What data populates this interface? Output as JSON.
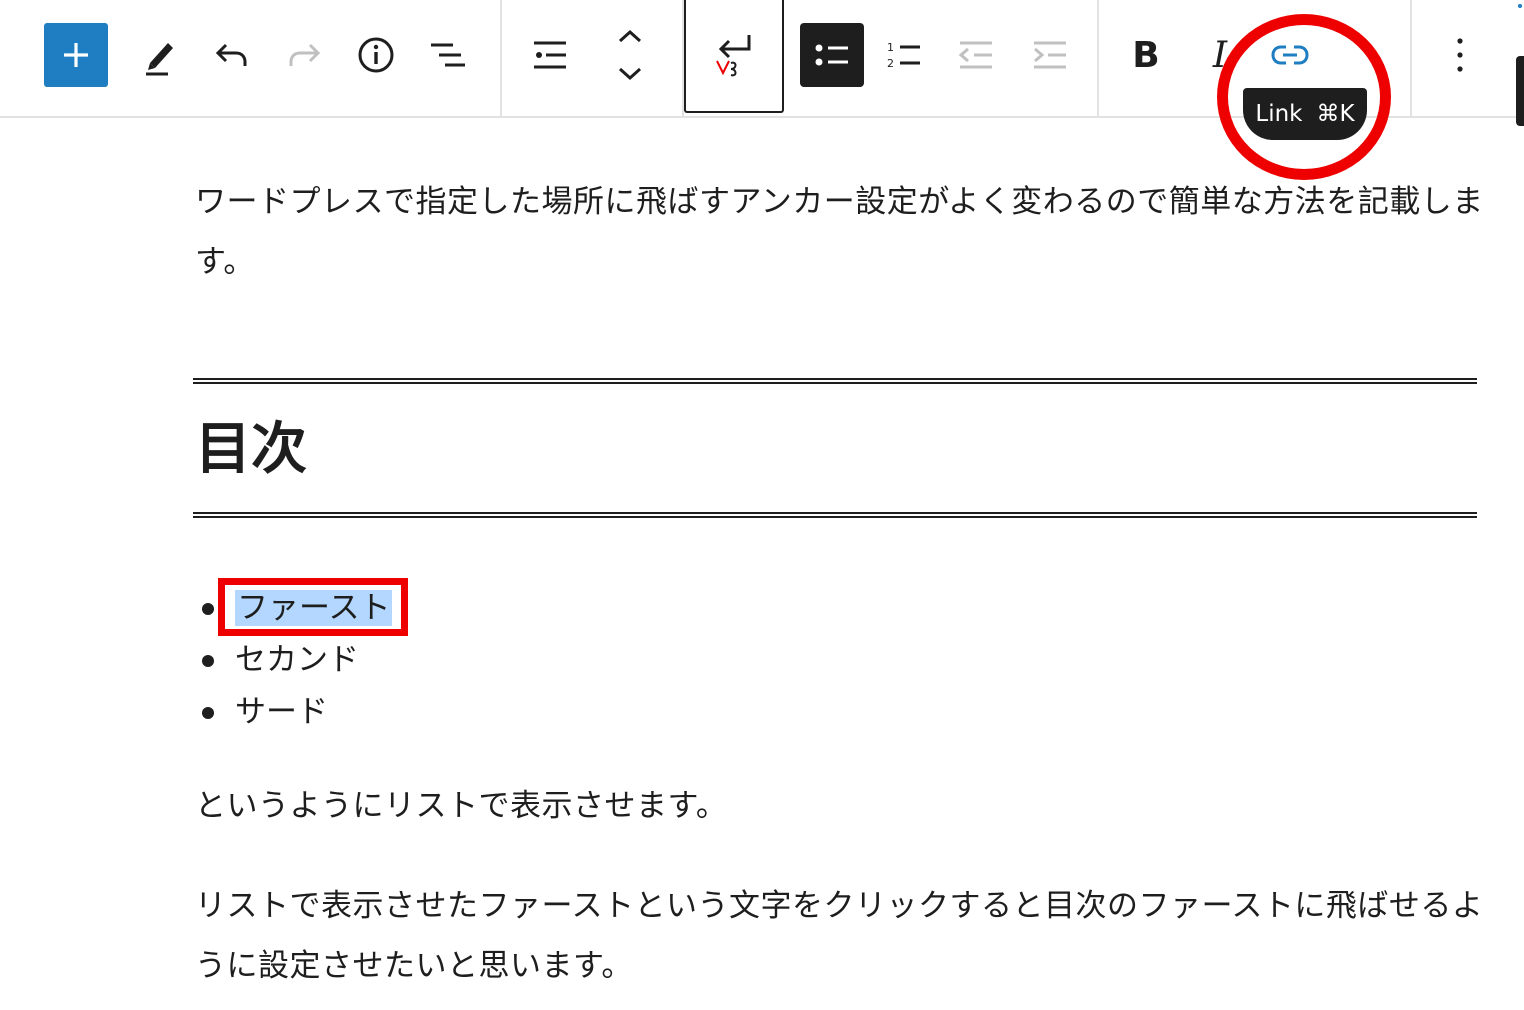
{
  "toolbar": {
    "buttons": [
      {
        "name": "add-block",
        "icon": "plus-icon"
      },
      {
        "name": "tools",
        "icon": "pencil-icon"
      },
      {
        "name": "undo",
        "icon": "undo-icon"
      },
      {
        "name": "redo",
        "icon": "redo-icon"
      },
      {
        "name": "details",
        "icon": "info-icon"
      },
      {
        "name": "list-view",
        "icon": "list-view-icon"
      },
      {
        "name": "block-type",
        "icon": "list-block-icon"
      },
      {
        "name": "move",
        "icon": "chevron-up-down-icon"
      },
      {
        "name": "line-break",
        "icon": "enter-icon"
      },
      {
        "name": "unordered-list",
        "icon": "bulleted-list-icon"
      },
      {
        "name": "ordered-list",
        "icon": "numbered-list-icon"
      },
      {
        "name": "outdent",
        "icon": "outdent-icon"
      },
      {
        "name": "indent",
        "icon": "indent-icon"
      },
      {
        "name": "link",
        "icon": "link-icon"
      },
      {
        "name": "more-options",
        "icon": "vertical-ellipsis-icon"
      }
    ],
    "bold_label": "B",
    "italic_label": "I",
    "tooltip": {
      "label": "Link",
      "shortcut": "⌘K"
    }
  },
  "content": {
    "intro": "ワードプレスで指定した場所に飛ばすアンカー設定がよく変わるので簡単な方法を記載します。",
    "heading": "目次",
    "list_items": [
      "ファースト",
      "セカンド",
      "サード"
    ],
    "after_list": "というようにリストで表示させます。",
    "explanation": "リストで表示させたファーストという文字をクリックすると目次のファーストに飛ばせるように設定させたいと思います。"
  },
  "colors": {
    "accent": "#1f7ec2",
    "annotation": "#ee0000",
    "selection": "#b3d7fe",
    "text": "#1e1e1e"
  }
}
